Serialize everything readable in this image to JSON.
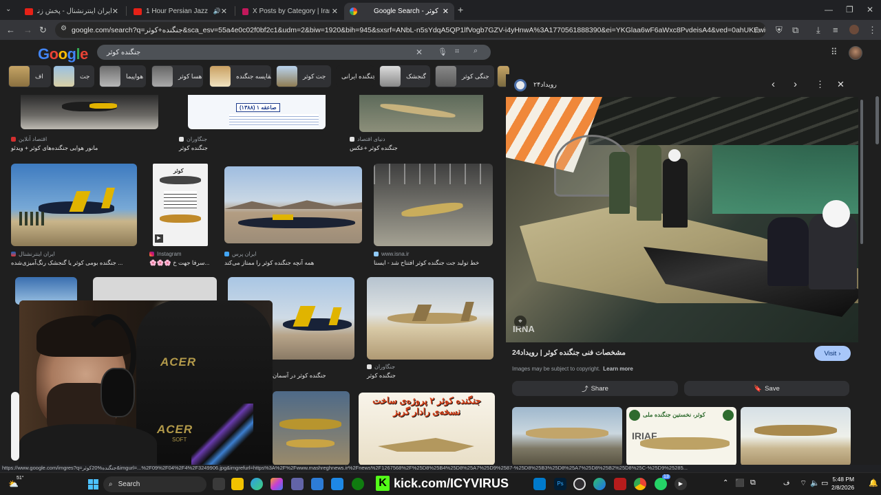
{
  "browser": {
    "tabs": [
      {
        "title": "ایران اینترنشنال - پخش زنده - ube",
        "favicon": "youtube-icon",
        "active": false
      },
      {
        "title": "1 Hour Persian Jazz – “Aghr",
        "favicon": "youtube-icon",
        "active": false
      },
      {
        "title": "X Posts by Category | Iran Mon",
        "favicon": "document-icon",
        "active": false
      },
      {
        "title": "Google Search - جنگنده کوثر",
        "favicon": "google-icon",
        "active": true
      }
    ],
    "address": "google.com/search?q=جنگنده+کوثر&sca_esv=55a4e0c02f0bf2c1&udm=2&biw=1920&bih=945&sxsrf=ANbL-n5sYdqA5QP1lfVogb7GZV-i4yHnwA%3A1770561888390&ei=YKGlaa6wF6aWxc8PvdeisA4&ved=0ahUKEwiu4KODkcqSAxUmS_E..."
  },
  "google": {
    "logo": "Google",
    "query": "جنگنده کوثر"
  },
  "chips": [
    {
      "label": "اف"
    },
    {
      "label": "جت"
    },
    {
      "label": "هواپیما"
    },
    {
      "label": "هسا کوثر"
    },
    {
      "label": "مقایسه جنگنده"
    },
    {
      "label": "جت کوثر"
    },
    {
      "label": "جنگنده ایرانی"
    },
    {
      "label": "گنجشک"
    },
    {
      "label": "جنگی کوثر"
    }
  ],
  "results": {
    "row1": [
      {
        "source": "اقتصاد آنلاین",
        "caption": "مانور هوایی جنگنده‌های کوثر + ویدئو"
      },
      {
        "source": "جنگاوران",
        "caption": "جنگنده کوثر",
        "image_text": "صاعقه ۱ (۱۳۸۸)"
      },
      {
        "source": "دنیای اقتصاد",
        "caption": "جنگنده کوثر +عکس"
      }
    ],
    "row2": [
      {
        "source": "ایران اینترنشنال",
        "caption": "جنگنده بومی کوثر یا گنجشک رنگ‌آمیزی‌شده ..."
      },
      {
        "source": "Instagram",
        "caption": "🌸🌸🌸 سرفا جهت خ...",
        "image_text": "کوثر"
      },
      {
        "source": "ایران پرس",
        "caption": "همه آنچه جنگنده کوثر را ممتاز می‌کند"
      },
      {
        "source": "www.isna.ir",
        "caption": "خط تولید جت جنگنده کوثر افتتاح شد - ایسنا"
      }
    ],
    "row3": [
      {
        "caption": "جنگنده کوثر در آسمان"
      },
      {
        "source": "جنگاوران",
        "caption": "جنگنده کوثر"
      }
    ],
    "row4_banner": "جنگنده کوثر ۲ پروژه‌ی ساخت نسخه‌ی رادار گریز"
  },
  "preview": {
    "site": "رویداد۲۴",
    "title": "مشخصات فنی جنگنده کوثر | رویداد24",
    "copyright": "Images may be subject to copyright.",
    "learn_more": "Learn more",
    "visit": "Visit",
    "share": "Share",
    "save": "Save",
    "watermark": "IRNA",
    "related": [
      {
        "text": ""
      },
      {
        "text": "کوثر، نخستین جنگنده ملی",
        "sub": "IRIAF"
      },
      {
        "text": ""
      }
    ]
  },
  "status_url": "https://www.google.com/imgres?q=جنگنده%20کوثر&imgurl=...%2F09%2F04%2F4%2F3249906.jpg&imgrefurl=https%3A%2F%2Fwww.mashreghnews.ir%2Fnews%2F1267568%2F%25D8%25B4%25D8%25A7%25D9%2587-%25D8%25B3%25D8%25A7%25D8%25B2%25D8%25C-%25D9%25285...",
  "taskbar": {
    "search": "Search",
    "weather": "51°",
    "stream": "kick.com/ICYVIRUS",
    "time": "5:48 PM",
    "date": "2/8/2026",
    "notif_badge": "13"
  },
  "webcam": {
    "brand": "ACER",
    "brand2": "SOFT"
  },
  "colors": {
    "accent": "#a8c7fa",
    "bg": "#1f1f1f",
    "kick": "#53fc18"
  }
}
